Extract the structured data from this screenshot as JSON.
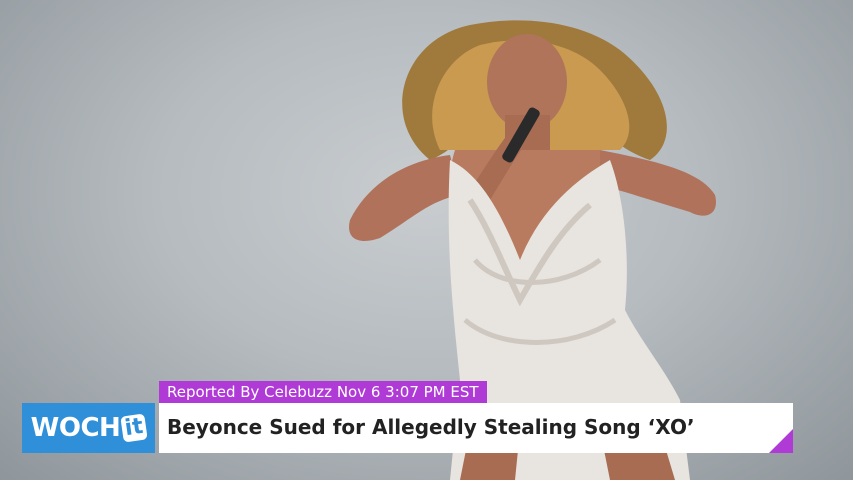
{
  "reporter": "Reported By Celebuzz Nov 6 3:07 PM EST",
  "logo": {
    "main": "WOCH",
    "badge": "it"
  },
  "headline": "Beyonce Sued for Allegedly Stealing Song ‘XO’",
  "colors": {
    "accent": "#b03ad6",
    "logo_blue": "#2f8fd8"
  }
}
